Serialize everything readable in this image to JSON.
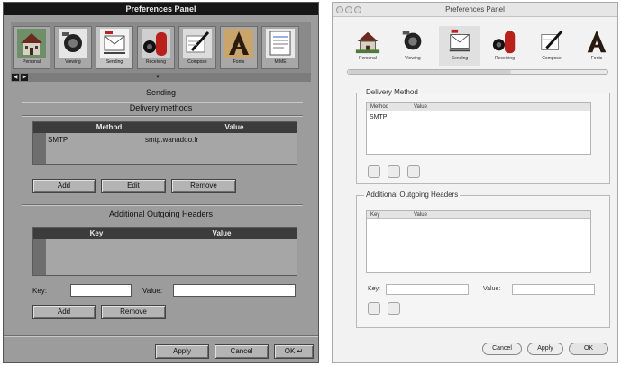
{
  "left_panel": {
    "title": "Preferences Panel",
    "toolbar": [
      {
        "label": "Personal",
        "icon": "house-icon"
      },
      {
        "label": "Viewing",
        "icon": "camera-icon"
      },
      {
        "label": "Sending",
        "icon": "outbox-icon"
      },
      {
        "label": "Receiving",
        "icon": "mailbox-icon"
      },
      {
        "label": "Compose",
        "icon": "pen-paper-icon"
      },
      {
        "label": "Fonts",
        "icon": "font-a-icon"
      },
      {
        "label": "MIME",
        "icon": "document-icon"
      }
    ],
    "section_title": "Sending",
    "delivery_group_title": "Delivery methods",
    "delivery_table": {
      "headers": [
        "Method",
        "Value"
      ],
      "rows": [
        {
          "method": "SMTP",
          "value": "smtp.wanadoo.fr"
        }
      ]
    },
    "delivery_buttons": {
      "add": "Add",
      "edit": "Edit",
      "remove": "Remove"
    },
    "headers_group_title": "Additional Outgoing Headers",
    "headers_table": {
      "headers": [
        "Key",
        "Value"
      ]
    },
    "key_label": "Key:",
    "value_label": "Value:",
    "headers_buttons": {
      "add": "Add",
      "remove": "Remove"
    },
    "footer_buttons": {
      "apply": "Apply",
      "cancel": "Cancel",
      "ok": "OK"
    }
  },
  "right_panel": {
    "title": "Preferences Panel",
    "toolbar": [
      {
        "label": "Personal",
        "icon": "house-icon"
      },
      {
        "label": "Viewing",
        "icon": "camera-icon"
      },
      {
        "label": "Sending",
        "icon": "outbox-icon"
      },
      {
        "label": "Receiving",
        "icon": "mailbox-icon"
      },
      {
        "label": "Compose",
        "icon": "pen-paper-icon"
      },
      {
        "label": "Fonts",
        "icon": "font-a-icon"
      }
    ],
    "delivery_group_title": "Delivery Method",
    "delivery_table": {
      "headers": [
        "Method",
        "Value"
      ],
      "rows": [
        {
          "method": "SMTP",
          "value": ""
        }
      ]
    },
    "headers_group_title": "Additional Outgoing Headers",
    "headers_table": {
      "headers": [
        "Key",
        "Value"
      ]
    },
    "key_label": "Key:",
    "value_label": "Value:",
    "footer_buttons": {
      "cancel": "Cancel",
      "apply": "Apply",
      "ok": "OK"
    }
  }
}
